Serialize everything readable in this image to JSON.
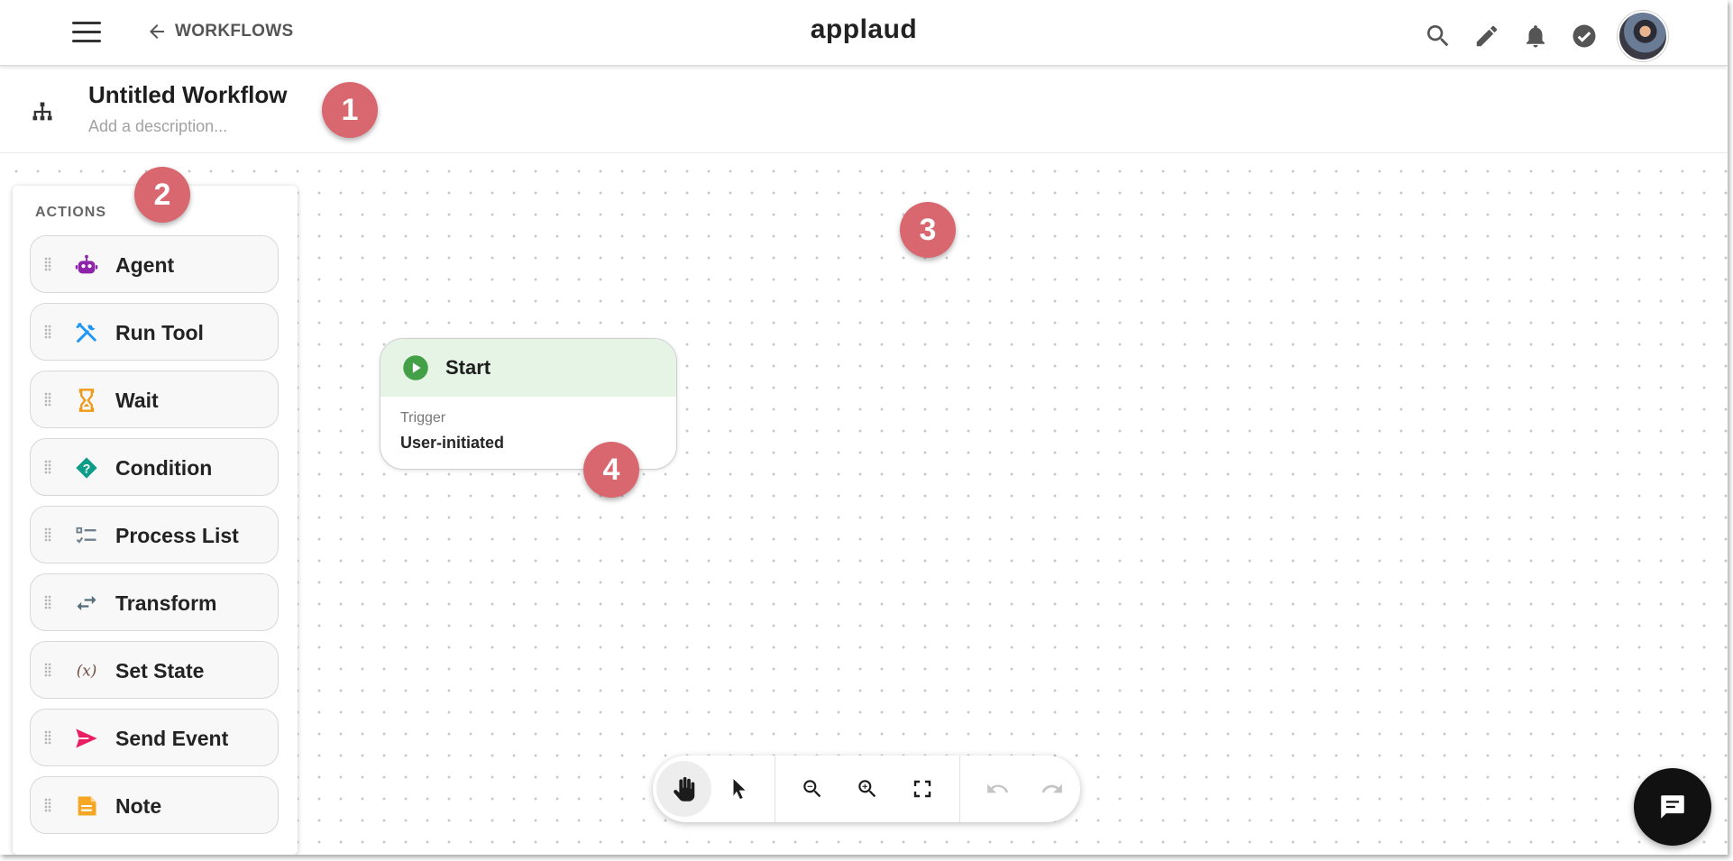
{
  "topbar": {
    "back_label": "WORKFLOWS",
    "brand": "applaud",
    "icons": [
      "search-icon",
      "pencil-icon",
      "bell-icon",
      "check-circle-icon",
      "avatar"
    ]
  },
  "workflow": {
    "title": "Untitled Workflow",
    "description_placeholder": "Add a description..."
  },
  "actions_panel": {
    "title": "ACTIONS",
    "items": [
      {
        "label": "Agent",
        "icon": "robot-icon",
        "color": "#8e24aa"
      },
      {
        "label": "Run Tool",
        "icon": "tools-icon",
        "color": "#2196f3"
      },
      {
        "label": "Wait",
        "icon": "hourglass-icon",
        "color": "#f09a1a"
      },
      {
        "label": "Condition",
        "icon": "diamond-question-icon",
        "color": "#0f9d8a"
      },
      {
        "label": "Process List",
        "icon": "checklist-icon",
        "color": "#6d7f8c"
      },
      {
        "label": "Transform",
        "icon": "swap-arrows-icon",
        "color": "#546e7a"
      },
      {
        "label": "Set State",
        "icon": "variable-icon",
        "color": "#6d4c41"
      },
      {
        "label": "Send Event",
        "icon": "send-icon",
        "color": "#e91e63"
      },
      {
        "label": "Note",
        "icon": "note-icon",
        "color": "#f5a623"
      }
    ]
  },
  "start_node": {
    "title": "Start",
    "sub_label": "Trigger",
    "value": "User-initiated",
    "header_color": "#e6f4e6",
    "icon_color": "#43a047"
  },
  "badges": [
    "1",
    "2",
    "3",
    "4"
  ],
  "toolbar": {
    "tools": [
      "hand-icon",
      "pointer-icon",
      "zoom-out-icon",
      "zoom-in-icon",
      "fit-screen-icon",
      "undo-icon",
      "redo-icon"
    ],
    "active": "hand-icon"
  },
  "colors": {
    "badge": "#d9676f",
    "chat_button": "#111111"
  }
}
